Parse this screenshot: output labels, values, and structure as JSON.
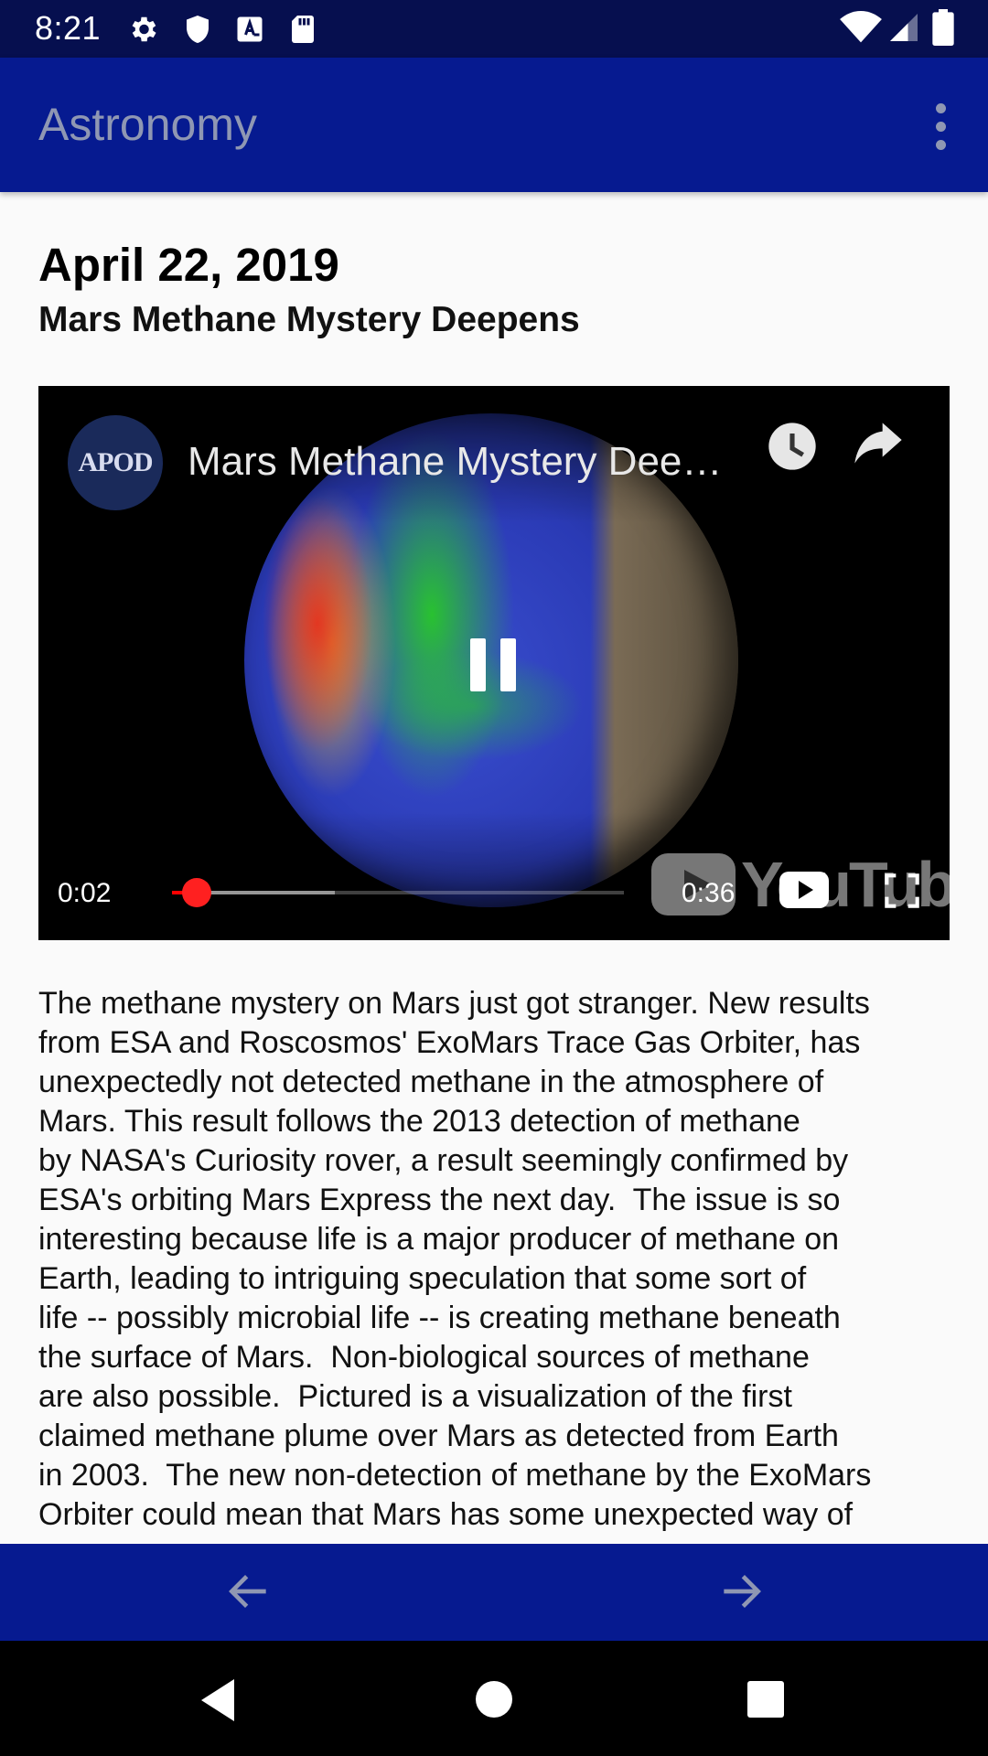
{
  "status_bar": {
    "time": "8:21",
    "left_icons": [
      "gear-icon",
      "shield-icon",
      "font-a-icon",
      "sd-card-icon"
    ],
    "right_icons": [
      "wifi-icon",
      "signal-icon",
      "battery-icon"
    ]
  },
  "app_bar": {
    "title": "Astronomy",
    "menu_icon": "more-vert-icon",
    "background": "#061a90",
    "title_color": "#8f97b3"
  },
  "apod": {
    "date": "April 22, 2019",
    "title": "Mars Methane Mystery Deepens",
    "explanation": "The methane mystery on Mars just got stranger. New results\nfrom ESA and Roscosmos' ExoMars Trace Gas Orbiter, has\nunexpectedly not detected methane in the atmosphere of\nMars. This result follows the 2013 detection of methane\nby NASA's Curiosity rover, a result seemingly confirmed by\nESA's orbiting Mars Express the next day.  The issue is so\ninteresting because life is a major producer of methane on\nEarth, leading to intriguing speculation that some sort of\nlife -- possibly microbial life -- is creating methane beneath\nthe surface of Mars.  Non-biological sources of methane\nare also possible.  Pictured is a visualization of the first\nclaimed methane plume over Mars as detected from Earth\nin 2003.  The new non-detection of methane by the ExoMars\nOrbiter could mean that Mars has some unexpected way of"
  },
  "video": {
    "channel_logo_text": "APOD",
    "title": "Mars Methane Mystery Dee…",
    "current_time": "0:02",
    "total_time": "0:36",
    "played_fraction": 0.055,
    "buffered_fraction": 0.36,
    "watermark": "YouTube",
    "icons": [
      "watch-later-icon",
      "share-icon",
      "pause-icon",
      "youtube-logo-icon",
      "fullscreen-icon"
    ],
    "progress_color": "#ff0000"
  },
  "bottom_nav": {
    "back_icon": "arrow-back-icon",
    "forward_icon": "arrow-forward-icon"
  },
  "system_nav": {
    "icons": [
      "back-triangle-icon",
      "home-circle-icon",
      "recents-square-icon"
    ]
  }
}
